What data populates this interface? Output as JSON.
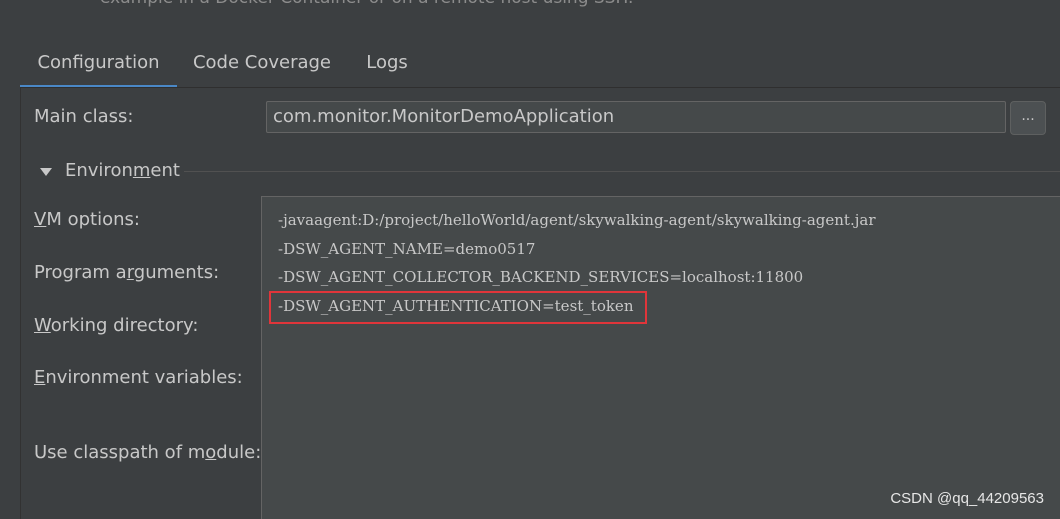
{
  "header": {
    "description": "example in a Docker Container or on a remote host using SSH."
  },
  "tabs": [
    {
      "label": "Configuration",
      "active": true
    },
    {
      "label": "Code Coverage",
      "active": false
    },
    {
      "label": "Logs",
      "active": false
    }
  ],
  "form": {
    "main_class_label": "Main class:",
    "main_class_value": "com.monitor.MonitorDemoApplication",
    "browse_label": "...",
    "environment_label_pre": "Environ",
    "environment_label_mnemonic": "m",
    "environment_label_post": "ent",
    "vm_options_mnemonic": "V",
    "vm_options_rest": "M options:",
    "program_args_pre": "Program a",
    "program_args_mnemonic": "r",
    "program_args_post": "guments:",
    "working_dir_mnemonic": "W",
    "working_dir_rest": "orking directory:",
    "env_vars_mnemonic": "E",
    "env_vars_rest": "nvironment variables:",
    "classpath_pre": "Use classpath of m",
    "classpath_mnemonic": "o",
    "classpath_post": "dule:"
  },
  "vm_options": {
    "lines": [
      "-javaagent:D:/project/helloWorld/agent/skywalking-agent/skywalking-agent.jar",
      "-DSW_AGENT_NAME=demo0517",
      "-DSW_AGENT_COLLECTOR_BACKEND_SERVICES=localhost:11800",
      "-DSW_AGENT_AUTHENTICATION=test_token"
    ]
  },
  "watermark": "CSDN @qq_44209563",
  "colors": {
    "background": "#3c3f41",
    "input_background": "#45494a",
    "tab_active_underline": "#4a88c7",
    "highlight_border": "#e0353a"
  }
}
